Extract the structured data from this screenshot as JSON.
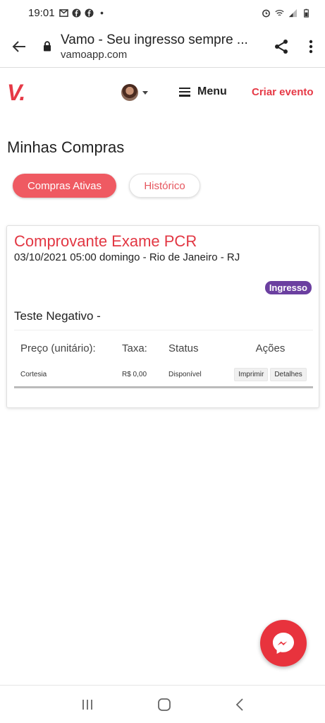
{
  "status": {
    "time": "19:01"
  },
  "browser": {
    "title": "Vamo - Seu ingresso sempre ...",
    "domain": "vamoapp.com"
  },
  "header": {
    "logo": "V",
    "logo_dot": ".",
    "menu_label": "Menu",
    "create_label": "Criar evento"
  },
  "page": {
    "heading": "Minhas Compras"
  },
  "tabs": [
    {
      "label": "Compras Ativas",
      "active": true
    },
    {
      "label": "Histórico",
      "active": false
    }
  ],
  "purchase": {
    "event_title": "Comprovante Exame PCR",
    "event_subtitle": "03/10/2021 05:00 domingo - Rio de Janeiro - RJ",
    "badge": "Ingresso",
    "ticket_name": "Teste Negativo -",
    "columns": [
      "Preço (unitário):",
      "Taxa:",
      "Status",
      "Ações"
    ],
    "row": {
      "price": "Cortesia",
      "fee": "R$ 0,00",
      "status": "Disponível",
      "print_label": "Imprimir",
      "details_label": "Detalhes"
    }
  },
  "colors": {
    "brand": "#e63946",
    "badge": "#6b3fa0",
    "messenger": "#e8333d"
  },
  "icons": [
    "back-arrow-icon",
    "lock-icon",
    "share-icon",
    "more-vert-icon",
    "hamburger-icon",
    "messenger-icon",
    "recents-icon",
    "home-icon",
    "nav-back-icon"
  ]
}
